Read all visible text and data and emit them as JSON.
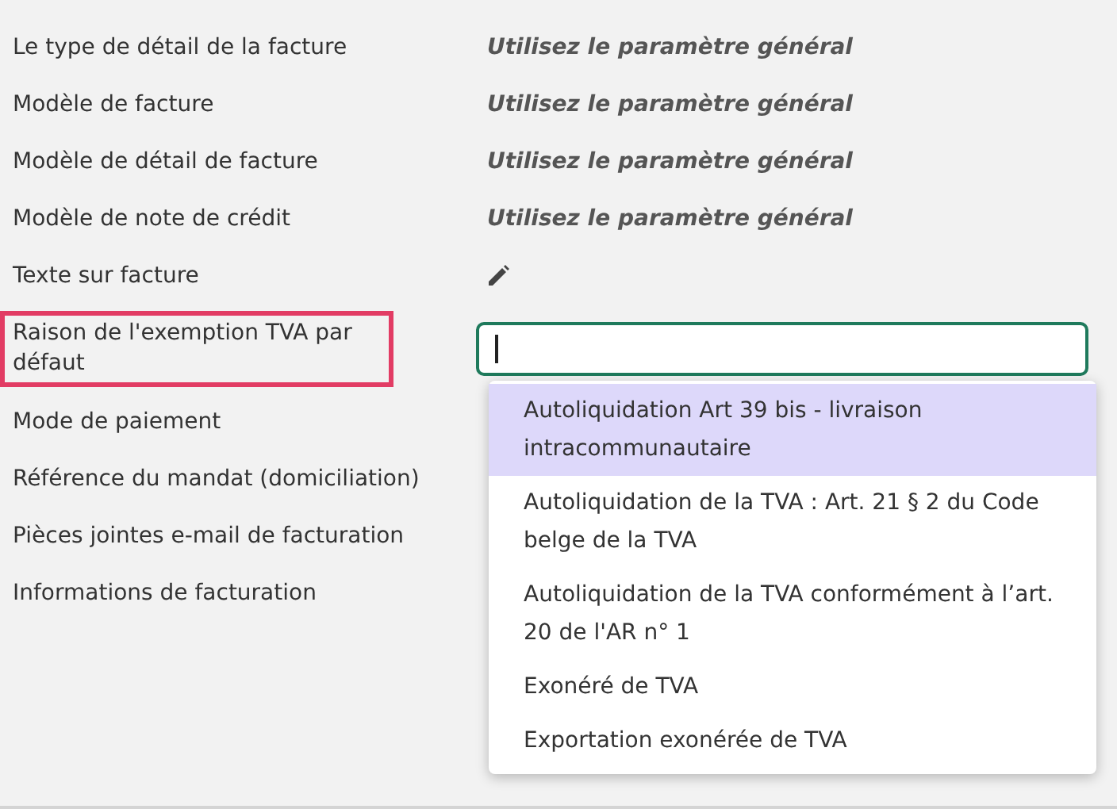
{
  "rows": [
    {
      "label": "Le type de détail de la facture",
      "kind": "text",
      "value": "Utilisez le paramètre général",
      "highlighted": false
    },
    {
      "label": "Modèle de facture",
      "kind": "text",
      "value": "Utilisez le paramètre général",
      "highlighted": false
    },
    {
      "label": "Modèle de détail de facture",
      "kind": "text",
      "value": "Utilisez le paramètre général",
      "highlighted": false
    },
    {
      "label": "Modèle de note de crédit",
      "kind": "text",
      "value": "Utilisez le paramètre général",
      "highlighted": false
    },
    {
      "label": "Texte sur facture",
      "kind": "edit",
      "highlighted": false
    },
    {
      "label": "Raison de l'exemption TVA par défaut",
      "kind": "select",
      "highlighted": true
    },
    {
      "label": "Mode de paiement",
      "kind": "none",
      "highlighted": false
    },
    {
      "label": "Référence du mandat (domiciliation)",
      "kind": "none",
      "highlighted": false
    },
    {
      "label": "Pièces jointes e-mail de facturation",
      "kind": "none",
      "highlighted": false
    },
    {
      "label": "Informations de facturation",
      "kind": "none",
      "highlighted": false
    }
  ],
  "dropdown": {
    "options": [
      {
        "label": "Autoliquidation Art 39 bis - livraison intracommunautaire",
        "selected": true
      },
      {
        "label": "Autoliquidation de la TVA : Art. 21 § 2 du Code belge de la TVA",
        "selected": false
      },
      {
        "label": "Autoliquidation de la TVA conformément à l’art. 20 de l'AR n° 1",
        "selected": false
      },
      {
        "label": "Exonéré de TVA",
        "selected": false
      },
      {
        "label": "Exportation exonérée de TVA",
        "selected": false
      }
    ]
  }
}
